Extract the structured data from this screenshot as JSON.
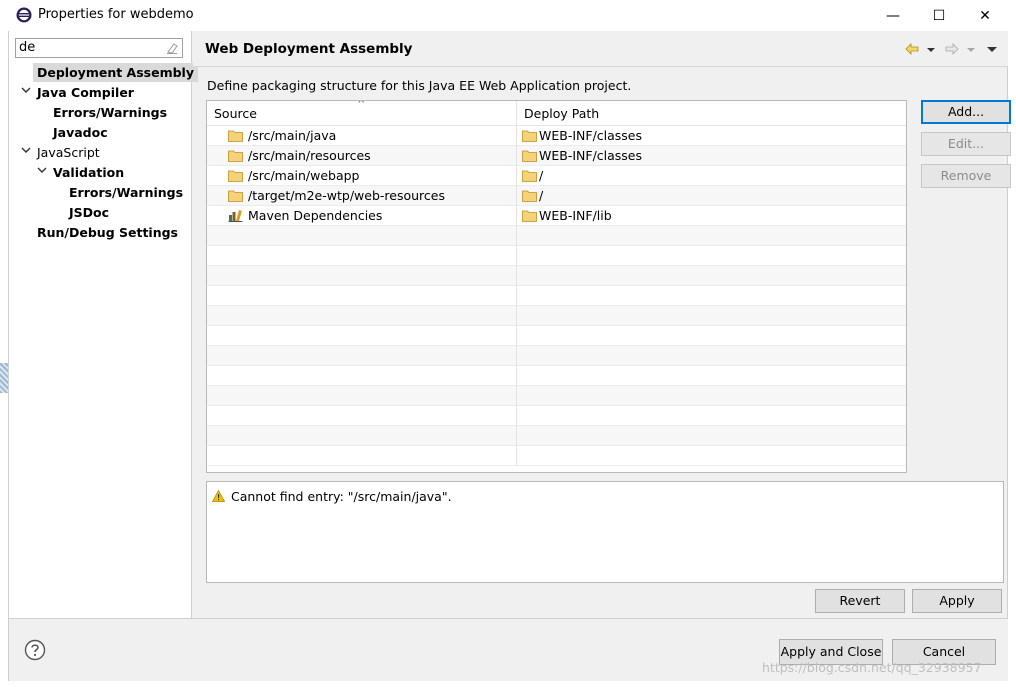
{
  "window": {
    "title": "Properties for webdemo",
    "icon": "eclipse-icon",
    "controls": {
      "minimize": "—",
      "maximize": "☐",
      "close": "✕"
    }
  },
  "filter": {
    "value": "de",
    "clear_icon": "eraser-icon"
  },
  "tree": {
    "items": [
      {
        "label": "Deployment Assembly",
        "selected": true
      },
      {
        "label": "Java Compiler",
        "expanded": true
      },
      {
        "label": "Errors/Warnings"
      },
      {
        "label": "Javadoc"
      },
      {
        "label": "JavaScript",
        "expanded": true
      },
      {
        "label": "Validation",
        "expanded": true
      },
      {
        "label": "Errors/Warnings"
      },
      {
        "label": "JSDoc"
      },
      {
        "label": "Run/Debug Settings"
      }
    ]
  },
  "page": {
    "title": "Web Deployment Assembly",
    "description": "Define packaging structure for this Java EE Web Application project.",
    "nav": {
      "back_icon": "arrow-left-icon",
      "forward_icon": "arrow-right-icon",
      "menu_icon": "view-menu-icon"
    }
  },
  "table": {
    "columns": [
      "Source",
      "Deploy Path"
    ],
    "sort_indicator": "^",
    "rows": [
      {
        "source": "/src/main/java",
        "source_icon": "folder-icon",
        "deploy": "WEB-INF/classes"
      },
      {
        "source": "/src/main/resources",
        "source_icon": "folder-icon",
        "deploy": "WEB-INF/classes"
      },
      {
        "source": "/src/main/webapp",
        "source_icon": "folder-icon",
        "deploy": "/"
      },
      {
        "source": "/target/m2e-wtp/web-resources",
        "source_icon": "folder-icon",
        "deploy": "/"
      },
      {
        "source": "Maven Dependencies",
        "source_icon": "library-icon",
        "deploy": "WEB-INF/lib"
      }
    ]
  },
  "side_buttons": {
    "add": "Add...",
    "edit": "Edit...",
    "remove": "Remove"
  },
  "message": {
    "icon": "warning-icon",
    "text": "Cannot find entry: \"/src/main/java\"."
  },
  "page_buttons": {
    "revert": "Revert",
    "apply": "Apply"
  },
  "dialog_buttons": {
    "apply_close": "Apply and Close",
    "cancel": "Cancel",
    "help_icon": "help-icon"
  },
  "watermark": "https://blog.csdn.net/qq_32938957",
  "colors": {
    "accent": "#0078d7",
    "selection": "#d9d9d9",
    "folder": "#e8b548",
    "warning": "#f0c000"
  }
}
